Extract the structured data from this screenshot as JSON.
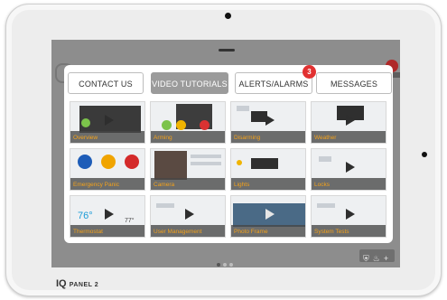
{
  "device": {
    "logo_mark": "IQ",
    "logo_text": "PANEL 2"
  },
  "tabs": [
    {
      "label": "CONTACT US",
      "active": false
    },
    {
      "label": "VIDEO TUTORIALS",
      "active": true
    },
    {
      "label": "ALERTS/ALARMS",
      "active": false,
      "badge": "3"
    },
    {
      "label": "MESSAGES",
      "active": false
    }
  ],
  "videos": [
    {
      "label": "Overview"
    },
    {
      "label": "Arming"
    },
    {
      "label": "Disarming"
    },
    {
      "label": "Weather"
    },
    {
      "label": "Emergency Panic"
    },
    {
      "label": "Camera"
    },
    {
      "label": "Lights"
    },
    {
      "label": "Locks"
    },
    {
      "label": "Thermostat",
      "temp": "76°",
      "temp2": "77°"
    },
    {
      "label": "User Management"
    },
    {
      "label": "Photo Frame"
    },
    {
      "label": "System Tests"
    }
  ],
  "pager": {
    "pages": 3,
    "current": 1
  },
  "colors": {
    "caption": "#f4a21a",
    "badge": "#e23131",
    "active_tab": "#9b9b9b",
    "screen_bg": "#8d8d8d"
  },
  "icons": {
    "corner": [
      "shield-icon",
      "flame-icon",
      "plus-icon"
    ]
  }
}
